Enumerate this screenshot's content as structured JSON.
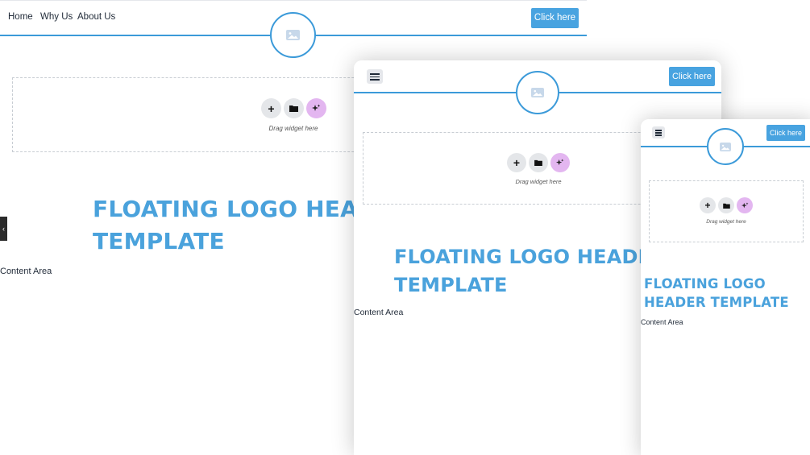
{
  "desktop": {
    "nav": [
      "Home",
      "Why Us",
      "About Us"
    ],
    "cta_label": "Click here",
    "drag_text": "Drag widget here",
    "hero_line1": "FLOATING LOGO HEADER",
    "hero_line2": "TEMPLATE",
    "content_label": "Content Area",
    "side_toggle": "‹"
  },
  "tablet": {
    "cta_label": "Click here",
    "drag_text": "Drag widget here",
    "hero_line1": "FLOATING LOGO HEADER",
    "hero_line2": "TEMPLATE",
    "content_label": "Content Area"
  },
  "mobile": {
    "cta_label": "Click here",
    "drag_text": "Drag widget here",
    "hero_line1": "FLOATING LOGO",
    "hero_line2": "HEADER TEMPLATE",
    "content_label": "Content Area"
  },
  "widget_icons": [
    "plus-icon",
    "folder-icon",
    "magic-sparkle-icon"
  ],
  "icons": {
    "add": "+",
    "logo": "image-placeholder-icon",
    "menu": "hamburger-menu-icon"
  },
  "colors": {
    "accent": "#48a3e0",
    "header_line": "#3b9ad9",
    "magic": "#e3b6f0",
    "logo_placeholder": "#c7d8ea"
  }
}
